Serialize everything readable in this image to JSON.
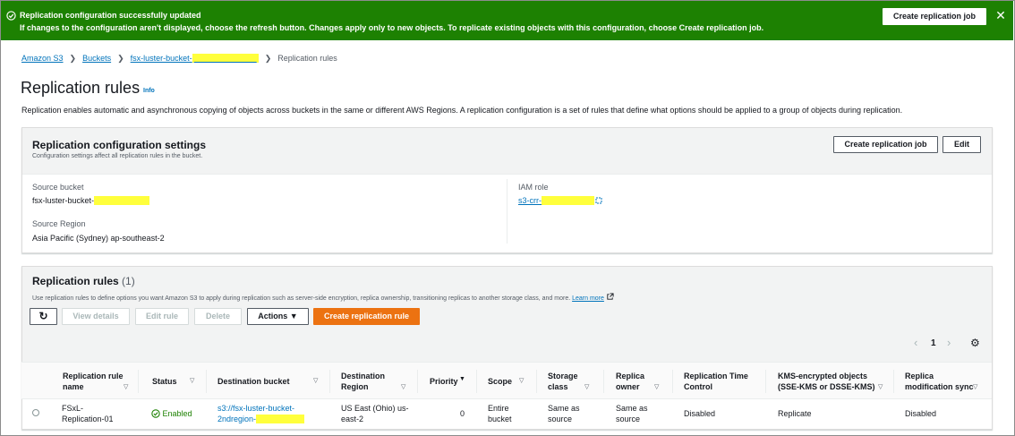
{
  "flash": {
    "title": "Replication configuration successfully updated",
    "message": "If changes to the configuration aren't displayed, choose the refresh button. Changes apply only to new objects. To replicate existing objects with this configuration, choose",
    "message_bold": "Create replication job.",
    "button": "Create replication job",
    "close": "✕",
    "color": "#1d8102"
  },
  "breadcrumb": {
    "items": [
      "Amazon S3",
      "Buckets",
      "fsx-luster-bucket-"
    ],
    "current": "Replication rules",
    "separator": "❯"
  },
  "page": {
    "title": "Replication rules",
    "info": "Info",
    "description": "Replication enables automatic and asynchronous copying of objects across buckets in the same or different AWS Regions. A replication configuration is a set of rules that define what options should be applied to a group of objects during replication."
  },
  "settings": {
    "title": "Replication configuration settings",
    "subtitle": "Configuration settings affect all replication rules in the bucket.",
    "create_job_button": "Create replication job",
    "edit_button": "Edit",
    "source_bucket_label": "Source bucket",
    "source_bucket_value": "fsx-luster-bucket-",
    "source_region_label": "Source Region",
    "source_region_value": "Asia Pacific (Sydney) ap-southeast-2",
    "iam_role_label": "IAM role",
    "iam_role_value": "s3-crr-"
  },
  "rules": {
    "title": "Replication rules",
    "count": "(1)",
    "description": "Use replication rules to define options you want Amazon S3 to apply during replication such as server-side encryption, replica ownership, transitioning replicas to another storage class, and more.",
    "learn_more": "Learn more",
    "buttons": {
      "refresh": "↻",
      "view_details": "View details",
      "edit_rule": "Edit rule",
      "delete": "Delete",
      "actions": "Actions ▼",
      "create_rule": "Create replication rule"
    },
    "pagination": {
      "prev": "‹",
      "page": "1",
      "next": "›",
      "settings": "⚙"
    },
    "columns": [
      "Replication rule name",
      "Status",
      "Destination bucket",
      "Destination Region",
      "Priority",
      "Scope",
      "Storage class",
      "Replica owner",
      "Replication Time Control",
      "KMS-encrypted objects (SSE-KMS or DSSE-KMS)",
      "Replica modification sync"
    ],
    "row": {
      "name": "FSxL-Replication-01",
      "status": "Enabled",
      "destination_bucket": "s3://fsx-luster-bucket-2ndregion-",
      "destination_region": "US East (Ohio) us-east-2",
      "priority": "0",
      "scope": "Entire bucket",
      "storage_class": "Same as source",
      "replica_owner": "Same as source",
      "rtc": "Disabled",
      "kms": "Replicate",
      "modification_sync": "Disabled"
    }
  }
}
